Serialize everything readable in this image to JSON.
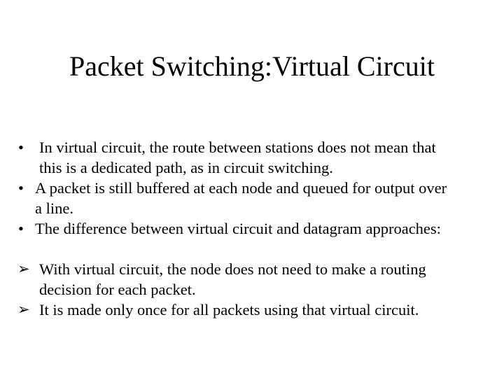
{
  "slide": {
    "title": "Packet Switching:Virtual Circuit",
    "background_color": "#ffffff",
    "text_color": "#000000",
    "bullet_marker": "•",
    "arrow_marker": "➢",
    "bullets": [
      {
        "marker": "•",
        "lines": [
          "In virtual circuit, the route between stations does not mean that",
          "this is a dedicated path, as in circuit switching."
        ]
      },
      {
        "marker": "•",
        "lines": [
          "A packet is still buffered at each node and queued for output over",
          "a line."
        ]
      },
      {
        "marker": "•",
        "lines": [
          "The difference between virtual circuit and datagram approaches:"
        ]
      }
    ],
    "sub_points": [
      {
        "marker": "➢",
        "lines": [
          "With virtual circuit, the node does not need to make a routing",
          "decision for each packet."
        ]
      },
      {
        "marker": "➢",
        "lines": [
          "It is made only once for all packets using that virtual circuit."
        ]
      }
    ]
  }
}
